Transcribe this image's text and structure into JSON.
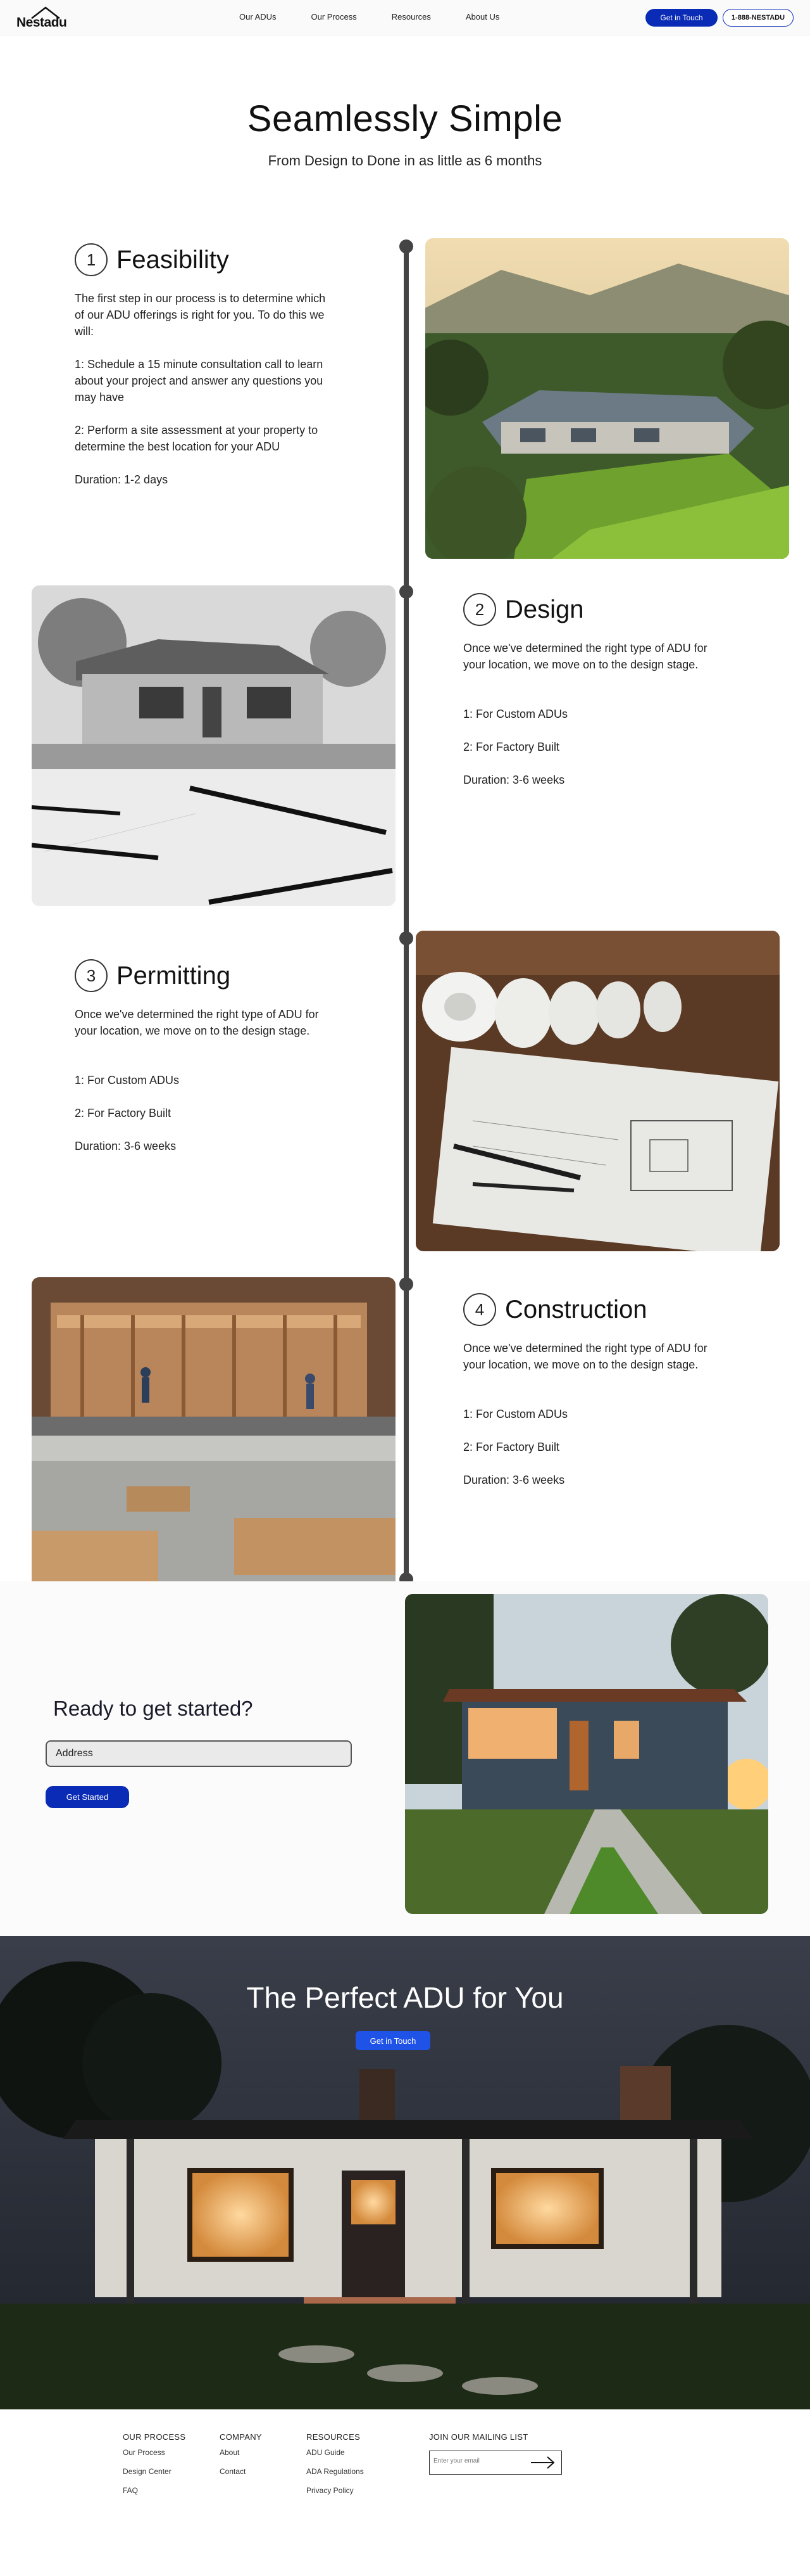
{
  "nav": {
    "logo": "Nestadu",
    "links": [
      "Our ADUs",
      "Our Process",
      "Resources",
      "About Us"
    ],
    "cta": "Get in Touch",
    "phone": "1-888-NESTADU"
  },
  "hero": {
    "title": "Seamlessly Simple",
    "subtitle": "From Design to Done in as little as 6 months"
  },
  "steps": [
    {
      "number": "1",
      "title": "Feasibility",
      "paragraphs": [
        "The first step in our process is to determine which of our ADU offerings is right for you. To do this we will:",
        "1: Schedule a 15 minute consultation call to learn about your project and answer any questions you may have",
        "2: Perform a site assessment at your property to determine the best location for your ADU",
        "Duration: 1-2 days"
      ]
    },
    {
      "number": "2",
      "title": "Design",
      "paragraphs": [
        "Once we've determined the right type of ADU for your location, we move on to the design stage.",
        "1: For Custom ADUs",
        "2: For Factory Built",
        "Duration: 3-6 weeks"
      ]
    },
    {
      "number": "3",
      "title": "Permitting",
      "paragraphs": [
        "Once we've determined the right type of ADU for your location, we move on to the design stage.",
        "1: For Custom ADUs",
        "2: For Factory Built",
        "Duration: 3-6 weeks"
      ]
    },
    {
      "number": "4",
      "title": "Construction",
      "paragraphs": [
        "Once we've determined the right type of ADU for your location, we move on to the design stage.",
        "1: For Custom ADUs",
        "2: For Factory Built",
        "Duration: 3-6 weeks"
      ]
    }
  ],
  "cta": {
    "title": "Ready to get started?",
    "input_value": "Address",
    "button": "Get Started"
  },
  "banner": {
    "title": "The Perfect ADU for You",
    "button": "Get in Touch"
  },
  "footer": {
    "columns": [
      {
        "heading": "OUR PROCESS",
        "links": [
          "Our Process",
          "Design Center",
          "FAQ"
        ]
      },
      {
        "heading": "COMPANY",
        "links": [
          "About",
          "Contact"
        ]
      },
      {
        "heading": "RESOURCES",
        "links": [
          "ADU Guide",
          "ADA Regulations",
          "Privacy Policy"
        ]
      }
    ],
    "mailing": {
      "heading": "JOIN OUR MAILING LIST",
      "placeholder": "Enter your email"
    }
  },
  "colors": {
    "primary": "#0a2bb5",
    "timeline": "#444444"
  }
}
